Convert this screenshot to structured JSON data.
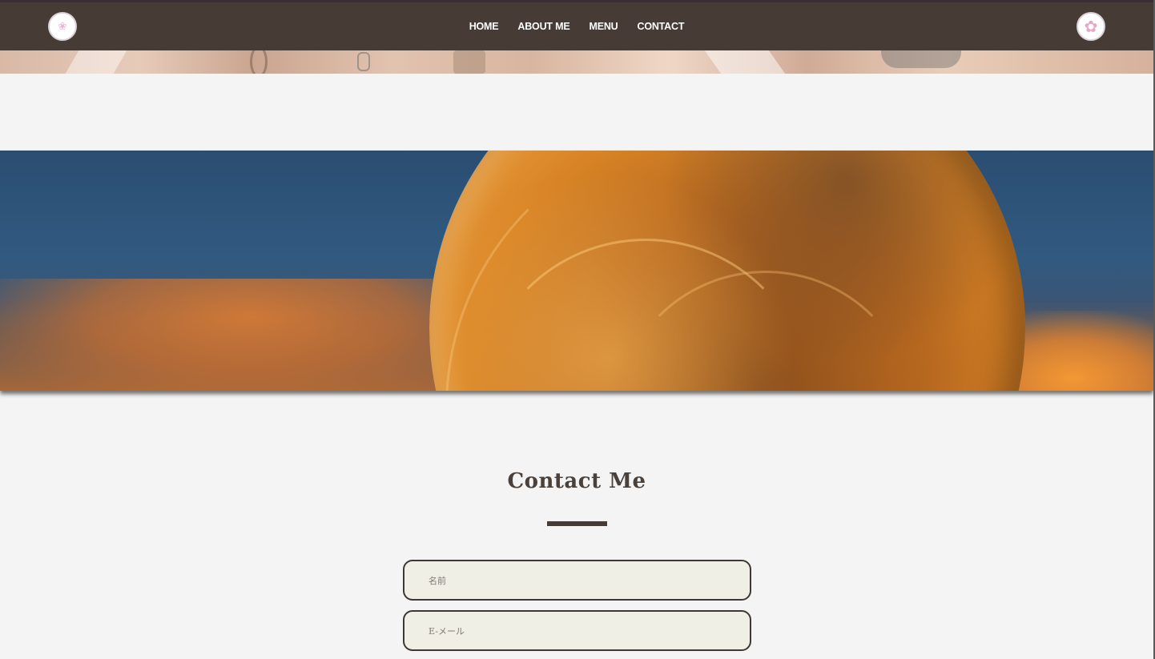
{
  "nav": {
    "links": [
      "HOME",
      "ABOUT ME",
      "MENU",
      "CONTACT"
    ],
    "logo_left_icon": "emblem-logo-icon",
    "logo_right_icon": "flower-logo-icon"
  },
  "contact": {
    "title": "Contact Me",
    "name_placeholder": "名前",
    "email_placeholder": "E-メール"
  },
  "colors": {
    "nav_bg": "#473c35",
    "page_bg": "#f4f4f4",
    "field_bg": "#efefe5",
    "accent": "#473c35"
  }
}
